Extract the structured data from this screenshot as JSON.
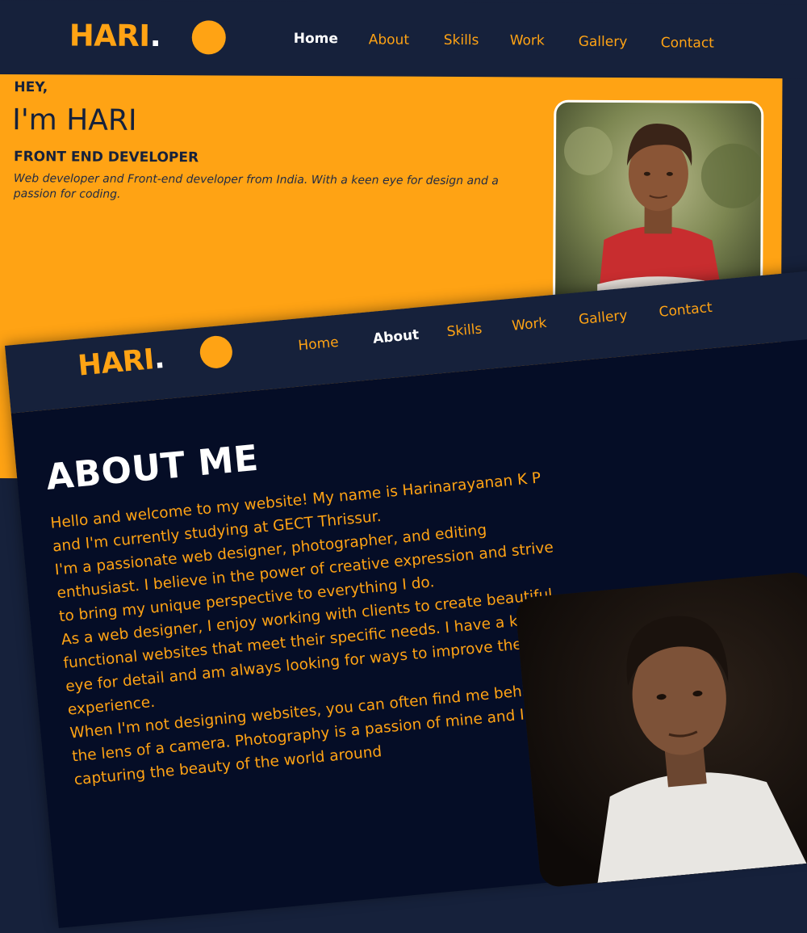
{
  "home_page": {
    "logo": {
      "text": "HARI",
      "dot": "."
    },
    "nav": [
      "Home",
      "About",
      "Skills",
      "Work",
      "Gallery",
      "Contact"
    ],
    "active_nav": "Home",
    "hero": {
      "greeting": "HEY,",
      "title": "I'm HARI",
      "role": "FRONT END DEVELOPER",
      "description": "Web developer and Front-end developer from India. With a keen eye for design and a passion for coding."
    },
    "photo_description": "portrait-photo-red-striped-shirt"
  },
  "about_page": {
    "logo": {
      "text": "HARI",
      "dot": "."
    },
    "nav": [
      "Home",
      "About",
      "Skills",
      "Work",
      "Gallery",
      "Contact"
    ],
    "active_nav": "About",
    "heading": "ABOUT ME",
    "paragraphs": [
      "Hello and welcome to my website! My name is Harinarayanan K P and I'm currently studying at GECT Thrissur.",
      "I'm a passionate web designer, photographer, and editing enthusiast. I believe in the power of creative expression and strive to bring my unique perspective to everything I do.",
      "As a web designer, I enjoy working with clients to create beautiful, functional websites that meet their specific needs. I have a keen eye for detail and am always looking for ways to improve the user experience.",
      "When I'm not designing websites, you can often find me behind the lens of a camera. Photography is a passion of mine and I love capturing the beauty of the world around"
    ],
    "photo_description": "portrait-photo-white-tshirt"
  },
  "colors": {
    "accent": "#ffa314",
    "nav_bg": "#16213b",
    "about_bg": "#050d26",
    "text_dark": "#16213b",
    "white": "#ffffff"
  }
}
